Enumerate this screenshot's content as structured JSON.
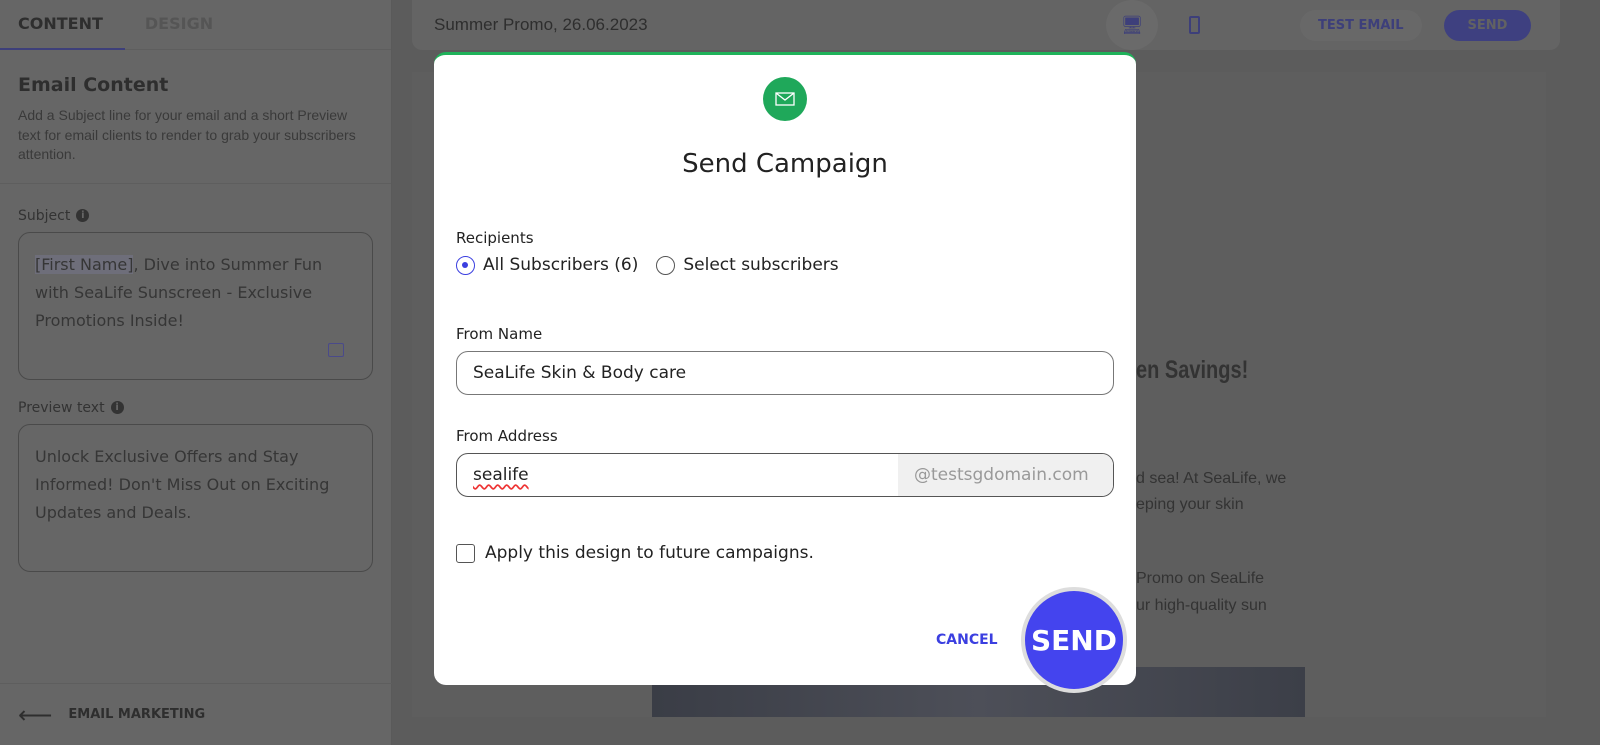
{
  "left": {
    "tabs": [
      "CONTENT",
      "DESIGN"
    ],
    "title": "Email Content",
    "desc": "Add a Subject line for your email and a short Preview text for email clients to render to grab your subscribers attention.",
    "subject_label": "Subject",
    "subject_tag": "[First Name]",
    "subject_rest": ", Dive into Summer Fun with SeaLife Sunscreen - Exclusive Promotions Inside!",
    "preview_label": "Preview text",
    "preview_value": "Unlock Exclusive Offers and Stay Informed! Don't Miss Out on Exciting Updates and Deals.",
    "back_label": "EMAIL MARKETING"
  },
  "top": {
    "title": "Summer Promo, 26.06.2023",
    "test_email": "TEST EMAIL",
    "send": "SEND"
  },
  "preview": {
    "heading": "en Savings!",
    "line1": "d sea! At SeaLife, we",
    "line2": "eping your skin",
    "line3": "Promo on SeaLife",
    "line4": "ur high-quality sun"
  },
  "modal": {
    "title": "Send Campaign",
    "recipients_label": "Recipients",
    "option_all": "All Subscribers (6)",
    "option_select": "Select subscribers",
    "from_name_label": "From Name",
    "from_name_value": "SeaLife Skin & Body care",
    "from_address_label": "From Address",
    "from_address_value": "sealife",
    "from_address_domain": "@testsgdomain.com",
    "apply_label": "Apply this design to future campaigns.",
    "cancel": "CANCEL",
    "send": "SEND",
    "selected_option": "All Subscribers (6)",
    "apply_checked": false
  },
  "colors": {
    "accent": "#3b3fe0",
    "success": "#1fa85a"
  }
}
